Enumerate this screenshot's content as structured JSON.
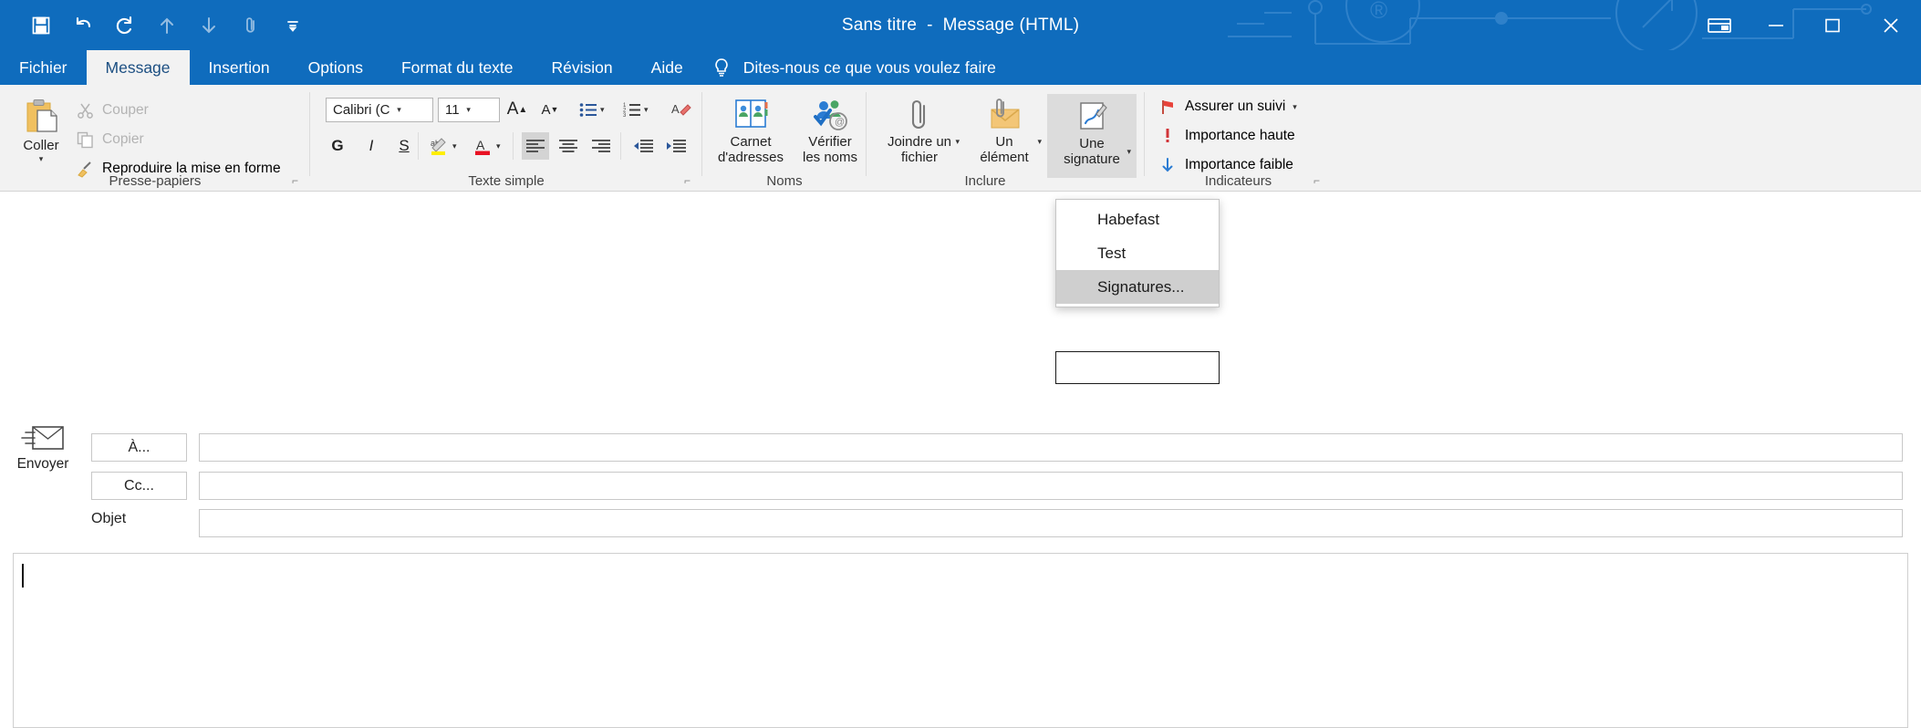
{
  "window": {
    "title": "Sans titre  -  Message (HTML)",
    "accent_color": "#0f6cbd",
    "quick_access": [
      {
        "name": "save-icon",
        "label": "Enregistrer"
      },
      {
        "name": "undo-icon",
        "label": "Annuler"
      },
      {
        "name": "redo-icon",
        "label": "Rétablir"
      },
      {
        "name": "move-up-icon",
        "label": "Haut"
      },
      {
        "name": "move-down-icon",
        "label": "Bas"
      },
      {
        "name": "attach-icon",
        "label": "Joindre"
      },
      {
        "name": "customize-qat-icon",
        "label": "Personnaliser"
      }
    ],
    "controls": [
      {
        "name": "ribbon-display-options",
        "glyph": "ribbon"
      },
      {
        "name": "minimize",
        "glyph": "minimize"
      },
      {
        "name": "maximize",
        "glyph": "maximize"
      },
      {
        "name": "close",
        "glyph": "close"
      }
    ]
  },
  "tabs": [
    {
      "label": "Fichier",
      "active": false
    },
    {
      "label": "Message",
      "active": true
    },
    {
      "label": "Insertion",
      "active": false
    },
    {
      "label": "Options",
      "active": false
    },
    {
      "label": "Format du texte",
      "active": false
    },
    {
      "label": "Révision",
      "active": false
    },
    {
      "label": "Aide",
      "active": false
    }
  ],
  "tell_me": {
    "placeholder": "Dites-nous ce que vous voulez faire",
    "icon": "lightbulb-icon"
  },
  "ribbon": {
    "groups": [
      {
        "id": "clipboard",
        "label": "Presse-papiers",
        "has_launcher": true
      },
      {
        "id": "basic_text",
        "label": "Texte simple",
        "has_launcher": true
      },
      {
        "id": "names",
        "label": "Noms",
        "has_launcher": false
      },
      {
        "id": "include",
        "label": "Inclure",
        "has_launcher": false
      },
      {
        "id": "tags",
        "label": "Indicateurs",
        "has_launcher": true
      }
    ],
    "clipboard": {
      "paste_label": "Coller",
      "cut_label": "Couper",
      "copy_label": "Copier",
      "format_painter_label": "Reproduire la mise en forme"
    },
    "basic_text": {
      "font_name": "Calibri (C",
      "font_size": "11",
      "grow_font": "A",
      "shrink_font": "A",
      "bold": "G",
      "italic": "I",
      "underline": "S"
    },
    "names": {
      "address_book_line1": "Carnet",
      "address_book_line2": "d'adresses",
      "check_names_line1": "Vérifier",
      "check_names_line2": "les noms"
    },
    "include": {
      "attach_file_line1": "Joindre un",
      "attach_file_line2": "fichier",
      "attach_item_line1": "Un",
      "attach_item_line2": "élément",
      "signature_line1": "Une",
      "signature_line2": "signature"
    },
    "tags": {
      "follow_up": "Assurer un suivi",
      "high_importance": "Importance haute",
      "low_importance": "Importance faible"
    },
    "collapse_ribbon_icon": "chevron-up-icon"
  },
  "signature_menu": {
    "items": [
      {
        "label": "Habefast",
        "selected": false
      },
      {
        "label": "Test",
        "selected": false
      },
      {
        "label": "Signatures...",
        "selected": true,
        "accel": "S"
      }
    ]
  },
  "compose": {
    "send_label": "Envoyer",
    "to_label": "À...",
    "cc_label": "Cc...",
    "subject_label": "Objet",
    "to_value": "",
    "cc_value": "",
    "subject_value": "",
    "body_value": ""
  }
}
